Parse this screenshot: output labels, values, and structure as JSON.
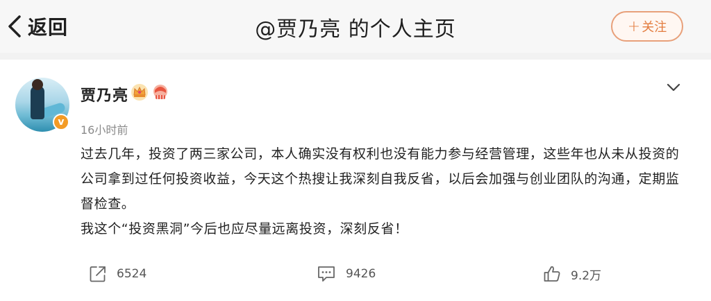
{
  "header": {
    "back_label": "返回",
    "title": "@贾乃亮 的个人主页",
    "follow_label": "关注",
    "follow_plus": "+"
  },
  "post": {
    "username": "贾乃亮",
    "verified_badge": "v",
    "timestamp": "16小时前",
    "paragraph_1": "过去几年，投资了两三家公司，本人确实没有权利也没有能力参与经营管理，这些年也从未从投资的公司拿到过任何投资收益，今天这个热搜让我深刻自我反省，以后会加强与创业团队的沟通，定期监督检查。",
    "paragraph_2": "我这个“投资黑洞”今后也应尽量远离投资，深刻反省！"
  },
  "actions": {
    "share_count": "6524",
    "comment_count": "9426",
    "like_count": "9.2万"
  },
  "colors": {
    "accent": "#e37c3f",
    "badge": "#f39b25"
  },
  "icons": [
    "back-chevron-icon",
    "crown-icon",
    "lion-icon",
    "chevron-down-icon",
    "share-icon",
    "comment-icon",
    "like-icon"
  ]
}
